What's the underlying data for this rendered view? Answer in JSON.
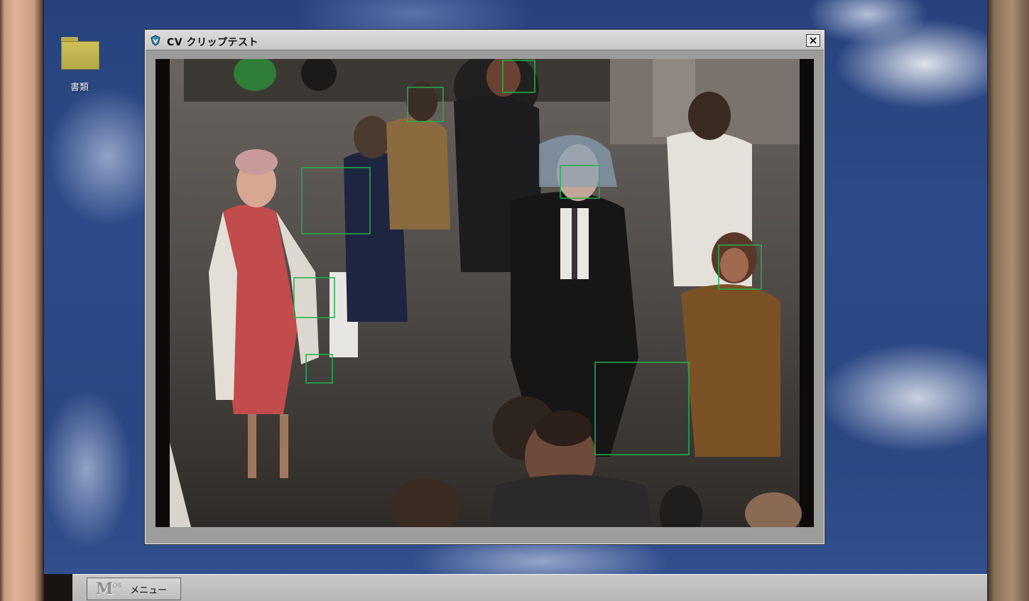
{
  "desktop": {
    "icons": [
      {
        "label": "書類",
        "icon": "folder-icon"
      }
    ]
  },
  "window": {
    "title": "CV クリップテスト",
    "icon": "cv-app-icon",
    "close": "close-icon",
    "content": "video-frame-crowd",
    "detections": 8,
    "detection_color": "#22b14c"
  },
  "taskbar": {
    "menu": {
      "logo": "M",
      "logo_sub": "OS",
      "label": "メニュー"
    }
  },
  "colors": {
    "desktop_sky": "#2d4b8a",
    "window_frame": "#9c9c9c",
    "taskbar": "#c0c0c0"
  }
}
